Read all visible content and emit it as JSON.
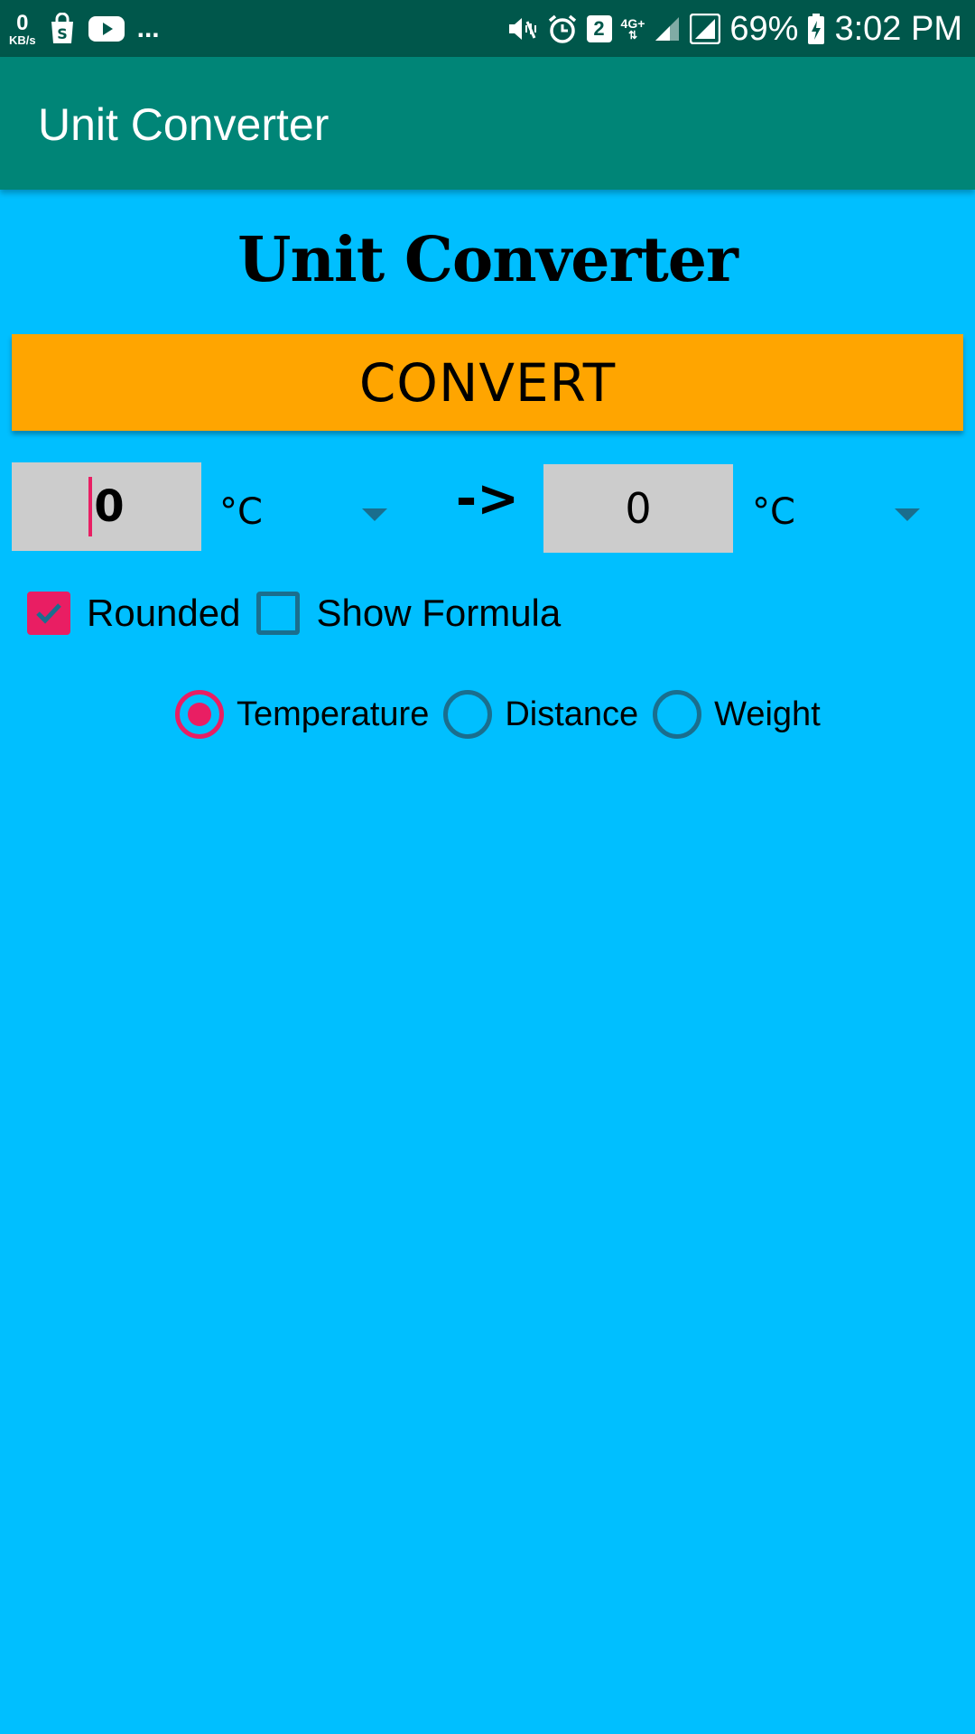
{
  "status_bar": {
    "net_speed_value": "0",
    "net_speed_unit": "KB/s",
    "overflow": "...",
    "sim_slot": "2",
    "network_type": "4G+",
    "battery": "69%",
    "time": "3:02 PM",
    "icons": [
      "shopping-bag-icon",
      "youtube-icon",
      "mute-vibrate-icon",
      "alarm-icon",
      "signal-icon",
      "battery-charging-icon"
    ]
  },
  "app_bar": {
    "title": "Unit Converter"
  },
  "main": {
    "title": "Unit Converter",
    "convert_label": "CONVERT",
    "from_value": "0",
    "from_unit": "°C",
    "arrow": "->",
    "to_value": "0",
    "to_unit": "°C",
    "checkboxes": [
      {
        "label": "Rounded",
        "checked": true
      },
      {
        "label": "Show Formula",
        "checked": false
      }
    ],
    "radios": [
      {
        "label": "Temperature",
        "selected": true
      },
      {
        "label": "Distance",
        "selected": false
      },
      {
        "label": "Weight",
        "selected": false
      }
    ]
  },
  "colors": {
    "status_bar": "#00574B",
    "app_bar": "#008577",
    "background": "#00BFFF",
    "button": "#FFA500",
    "accent": "#E91E63"
  }
}
